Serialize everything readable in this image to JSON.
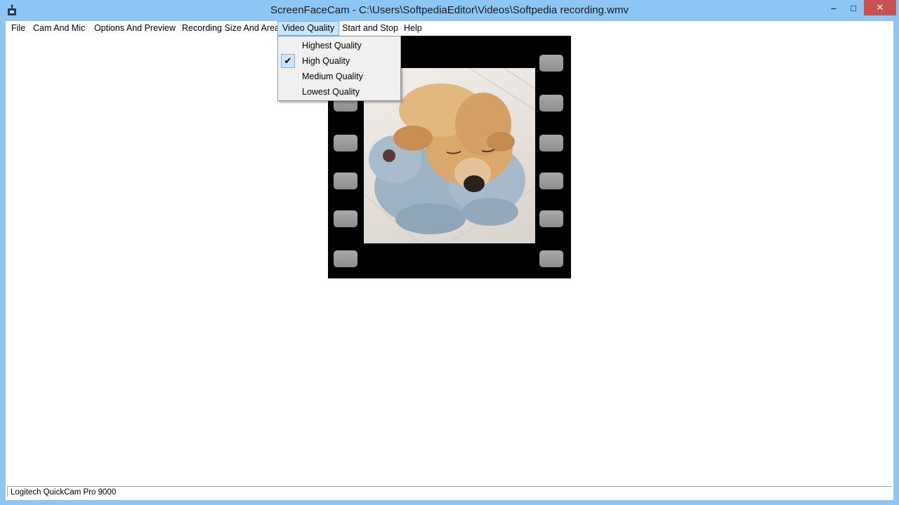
{
  "window": {
    "title": "ScreenFaceCam - C:\\Users\\SoftpediaEditor\\Videos\\Softpedia recording.wmv",
    "minimize_glyph": "–",
    "maximize_glyph": "□",
    "close_glyph": "✕"
  },
  "menubar": {
    "items": [
      {
        "label": "File"
      },
      {
        "label": "Cam And Mic"
      },
      {
        "label": "Options And Preview"
      },
      {
        "label": "Recording Size And Area"
      },
      {
        "label": "Video Quality"
      },
      {
        "label": "Start and Stop"
      },
      {
        "label": "Help"
      }
    ]
  },
  "video_quality_menu": {
    "items": [
      {
        "label": "Highest Quality",
        "checked": false
      },
      {
        "label": "High Quality",
        "checked": true
      },
      {
        "label": "Medium Quality",
        "checked": false
      },
      {
        "label": "Lowest Quality",
        "checked": false
      }
    ],
    "check_glyph": "✔"
  },
  "statusbar": {
    "device": "Logitech QuickCam Pro 9000"
  },
  "colors": {
    "window_frame": "#8cc6f5",
    "menu_highlight": "#cce4f7",
    "close_button": "#c75050"
  },
  "icons": [
    "app-icon",
    "minimize-icon",
    "maximize-icon",
    "close-icon",
    "checkmark-icon"
  ]
}
